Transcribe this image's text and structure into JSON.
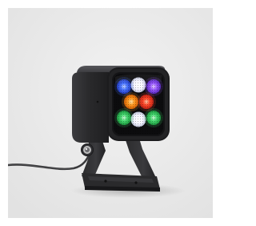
{
  "image": {
    "subject": "rgb-led-spotlight-icon",
    "colors": {
      "background": "#ececec",
      "housing": "#2c2c2e",
      "housing_highlight": "#4a4a4d",
      "bracket": "#333335",
      "lens_frame": "#1a1a1a",
      "led_blue": "#2e5bff",
      "led_white": "#ffffff",
      "led_purple": "#8a4dff",
      "led_orange": "#ff8a1e",
      "led_red": "#ff3a2a",
      "led_green": "#3fd46a",
      "cable": "#3a3a3c"
    },
    "leds": [
      {
        "color": "blue"
      },
      {
        "color": "white"
      },
      {
        "color": "purple"
      },
      {
        "color": "orange"
      },
      {
        "color": "red"
      },
      {
        "color": "green"
      },
      {
        "color": "white"
      },
      {
        "color": "green"
      }
    ]
  }
}
